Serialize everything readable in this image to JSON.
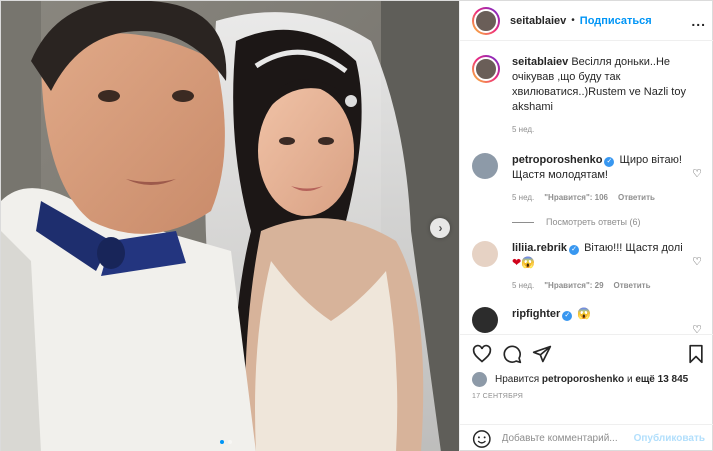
{
  "header": {
    "username": "seitablaiev",
    "separator": "•",
    "follow_label": "Подписаться",
    "more_label": "..."
  },
  "caption": {
    "username": "seitablaiev",
    "text": "Весілля доньки..Не очікував ,що буду так хвилюватися..)Rustem ve Nazli toy akshami",
    "time": "5 нед."
  },
  "comments": [
    {
      "username": "petroporoshenko",
      "verified": true,
      "text": "Щиро вітаю! Щастя молодятам!",
      "time": "5 нед.",
      "likes": "\"Нравится\": 106",
      "reply_label": "Ответить",
      "view_replies": "Посмотреть ответы (6)"
    },
    {
      "username": "liliia.rebrik",
      "verified": true,
      "text": "Вітаю!!! Щастя долі",
      "emoji": "❤😱",
      "time": "5 нед.",
      "likes": "\"Нравится\": 29",
      "reply_label": "Ответить"
    },
    {
      "username": "ripfighter",
      "verified": true,
      "emoji": "😱"
    }
  ],
  "icons": {
    "heart": "heart-icon",
    "comment": "comment-icon",
    "share": "share-icon",
    "bookmark": "bookmark-icon",
    "verified_glyph": "✓",
    "next_glyph": "›",
    "like_small": "♡"
  },
  "likes": {
    "prefix": "Нравится",
    "user": "petroporoshenko",
    "and": "и",
    "others": "ещё 13 845"
  },
  "date": "17 СЕНТЯБРЯ",
  "add_comment": {
    "placeholder": "Добавьте комментарий...",
    "post_label": "Опубликовать"
  },
  "colors": {
    "accent": "#0095f6",
    "verified": "#3897f0",
    "post_disabled": "#b2dffc"
  }
}
